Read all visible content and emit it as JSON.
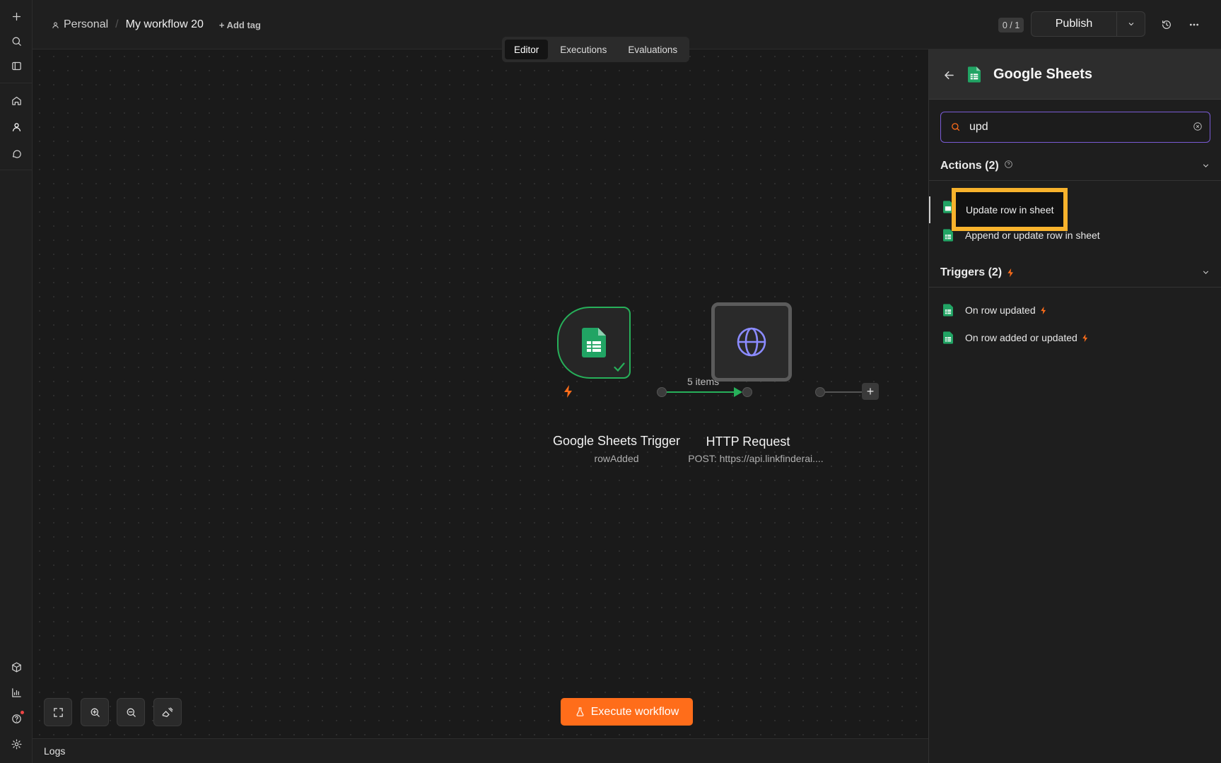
{
  "header": {
    "project": "Personal",
    "workflow_title": "My workflow 20",
    "add_tag": "+ Add tag",
    "counter": "0 / 1",
    "publish_label": "Publish"
  },
  "tabs": [
    {
      "label": "Editor",
      "active": true
    },
    {
      "label": "Executions",
      "active": false
    },
    {
      "label": "Evaluations",
      "active": false
    }
  ],
  "canvas": {
    "nodes": [
      {
        "title": "Google Sheets Trigger",
        "subtitle": "rowAdded"
      },
      {
        "title": "HTTP Request",
        "subtitle": "POST: https://api.linkfinderai...."
      }
    ],
    "connection_label": "5 items",
    "execute_label": "Execute workflow",
    "logs_label": "Logs"
  },
  "panel": {
    "title": "Google Sheets",
    "search": {
      "value": "upd"
    },
    "actions": {
      "header": "Actions (2)",
      "items": [
        "Update row in sheet",
        "Append or update row in sheet"
      ]
    },
    "triggers": {
      "header": "Triggers (2)",
      "items": [
        "On row updated",
        "On row added or updated"
      ]
    }
  },
  "colors": {
    "accent": "#ff6d1a",
    "success": "#27b05a",
    "highlight": "#f7b22c",
    "search_focus": "#7a5bd6"
  }
}
